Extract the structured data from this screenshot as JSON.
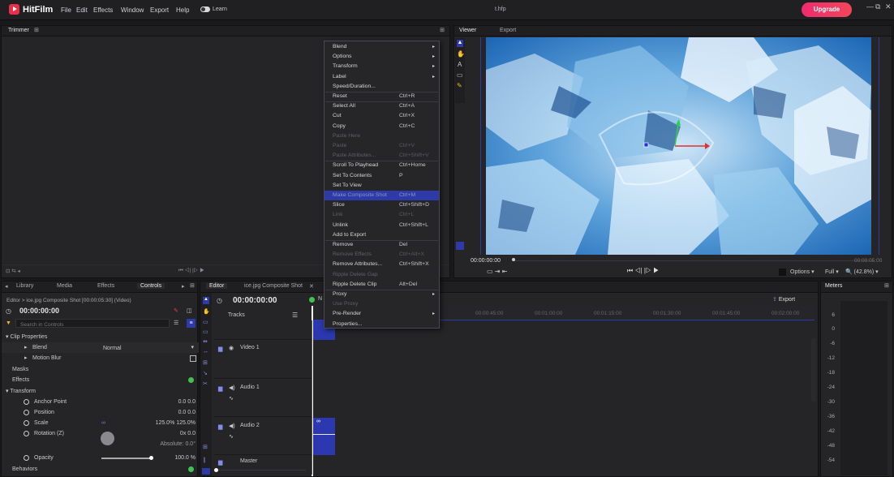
{
  "app": {
    "name": "HitFilm",
    "doc_title": "t.hfp",
    "upgrade": "Upgrade",
    "learn": "Learn"
  },
  "menu": [
    "File",
    "Edit",
    "Effects",
    "Window",
    "Export",
    "Help"
  ],
  "trimmer": {
    "tab": "Trimmer"
  },
  "viewer": {
    "tabs": [
      "Viewer",
      "Export"
    ],
    "timecode_left": "00:00:00:00",
    "timecode_right": "00:00:05:00",
    "options": "Options",
    "full": "Full",
    "zoom": "(42.8%)"
  },
  "context_menu": [
    {
      "label": "Blend",
      "submenu": true
    },
    {
      "label": "Options",
      "submenu": true
    },
    {
      "label": "Transform",
      "submenu": true
    },
    {
      "label": "Label",
      "submenu": true
    },
    {
      "label": "Speed/Duration..."
    },
    {
      "label": "Reset",
      "shortcut": "Ctrl+R"
    },
    {
      "label": "Select All",
      "shortcut": "Ctrl+A"
    },
    {
      "label": "Cut",
      "shortcut": "Ctrl+X"
    },
    {
      "label": "Copy",
      "shortcut": "Ctrl+C"
    },
    {
      "label": "Paste Here",
      "disabled": true
    },
    {
      "label": "Paste",
      "shortcut": "Ctrl+V",
      "disabled": true
    },
    {
      "label": "Paste Attributes...",
      "shortcut": "Ctrl+Shift+V",
      "disabled": true
    },
    {
      "label": "Scroll To Playhead",
      "shortcut": "Ctrl+Home"
    },
    {
      "label": "Set To Contents",
      "shortcut": "P"
    },
    {
      "label": "Set To View"
    },
    {
      "label": "Make Composite Shot",
      "shortcut": "Ctrl+M",
      "highlighted": true
    },
    {
      "label": "Slice",
      "shortcut": "Ctrl+Shift+D"
    },
    {
      "label": "Link",
      "shortcut": "Ctrl+L",
      "disabled": true
    },
    {
      "label": "Unlink",
      "shortcut": "Ctrl+Shift+L"
    },
    {
      "label": "Add to Export"
    },
    {
      "label": "Remove",
      "shortcut": "Del"
    },
    {
      "label": "Remove Effects",
      "shortcut": "Ctrl+Alt+X",
      "disabled": true
    },
    {
      "label": "Remove Attributes...",
      "shortcut": "Ctrl+Shift+X"
    },
    {
      "label": "Ripple Delete Gap",
      "disabled": true
    },
    {
      "label": "Ripple Delete Clip",
      "shortcut": "Alt+Del"
    },
    {
      "label": "Proxy",
      "submenu": true
    },
    {
      "label": "Use Proxy",
      "disabled": true
    },
    {
      "label": "Pre-Render",
      "submenu": true
    },
    {
      "label": "Properties..."
    }
  ],
  "left_panel": {
    "tabs": [
      "Library",
      "Media",
      "Effects",
      "Controls"
    ],
    "breadcrumb": "Editor > ice.jpg Composite Shot [00:00:05:30] (Video)",
    "timecode": "00:00:00:00",
    "search_placeholder": "Search in Controls",
    "clip_properties": "Clip Properties",
    "blend": "Blend",
    "blend_value": "Normal",
    "motion_blur": "Motion Blur",
    "masks": "Masks",
    "effects": "Effects",
    "transform": "Transform",
    "anchor_point": "Anchor Point",
    "anchor_values": "0.0  0.0",
    "position": "Position",
    "position_values": "0.0  0.0",
    "scale": "Scale",
    "scale_values": "125.0%  125.0%",
    "rotation": "Rotation (Z)",
    "rotation_values": "0x    0.0",
    "absolute": "Absolute: 0.0°",
    "opacity": "Opacity",
    "opacity_value": "100.0 %",
    "opacity_level": 1.0,
    "behaviors": "Behaviors"
  },
  "editor": {
    "tabs": [
      "Editor",
      "ice.jpg Composite Shot"
    ],
    "timecode": "00:00:00:00",
    "tracks_label": "Tracks",
    "export": "Export",
    "new_label": "N",
    "tracks": [
      "Video 1",
      "Audio 1",
      "Audio 2",
      "Master"
    ],
    "ruler": [
      "00:00:45:00",
      "00:01:00:00",
      "00:01:15:00",
      "00:01:30:00",
      "00:01:45:00",
      "00:02:00:00"
    ]
  },
  "meters": {
    "tab": "Meters",
    "scale": [
      "6",
      "0",
      "-6",
      "-12",
      "-18",
      "-24",
      "-30",
      "-36",
      "-42",
      "-48",
      "-54"
    ]
  },
  "colors": {
    "accent": "#2e3aa8",
    "brand": "#e8304a",
    "upgrade": "#ee2c6e"
  }
}
